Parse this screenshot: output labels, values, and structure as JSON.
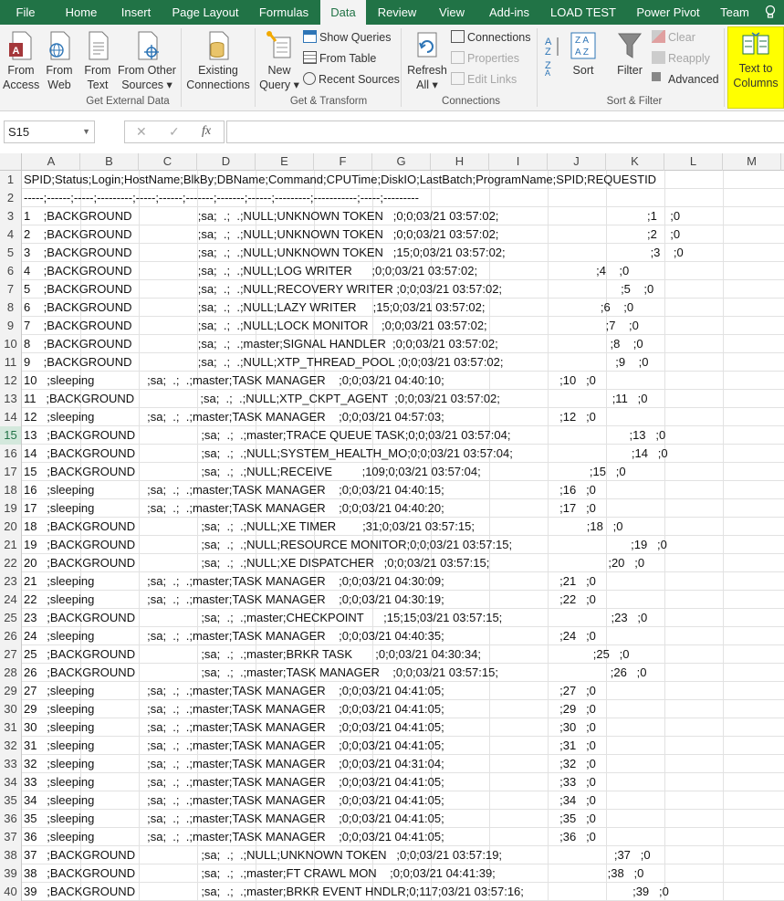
{
  "tabs": [
    "File",
    "Home",
    "Insert",
    "Page Layout",
    "Formulas",
    "Data",
    "Review",
    "View",
    "Add-ins",
    "LOAD TEST",
    "Power Pivot",
    "Team"
  ],
  "ribbon": {
    "get_external": {
      "from_access": [
        "From",
        "Access"
      ],
      "from_web": [
        "From",
        "Web"
      ],
      "from_text": [
        "From",
        "Text"
      ],
      "from_other": [
        "From Other",
        "Sources ▾"
      ],
      "existing": [
        "Existing",
        "Connections"
      ],
      "label": "Get External Data"
    },
    "get_transform": {
      "new_query": [
        "New",
        "Query ▾"
      ],
      "show_queries": "Show Queries",
      "from_table": "From Table",
      "recent_sources": "Recent Sources",
      "label": "Get & Transform"
    },
    "connections": {
      "refresh_all": [
        "Refresh",
        "All ▾"
      ],
      "connections": "Connections",
      "properties": "Properties",
      "edit_links": "Edit Links",
      "label": "Connections"
    },
    "sort_filter": {
      "sort": "Sort",
      "filter": "Filter",
      "clear": "Clear",
      "reapply": "Reapply",
      "advanced": "Advanced",
      "label": "Sort & Filter"
    },
    "data_tools": {
      "text_to_columns": [
        "Text to",
        "Columns"
      ]
    }
  },
  "formula_bar": {
    "name_box": "S15",
    "cancel": "✕",
    "enter": "✓",
    "fx": "fx",
    "formula": ""
  },
  "columns": [
    "A",
    "B",
    "C",
    "D",
    "E",
    "F",
    "G",
    "H",
    "I",
    "J",
    "K",
    "L",
    "M"
  ],
  "selected_row": 15,
  "rows": [
    {
      "n": "1",
      "text": "SPID;Status;Login;HostName;BlkBy;DBName;Command;CPUTime;DiskIO;LastBatch;ProgramName;SPID;REQUESTID"
    },
    {
      "n": "2",
      "text": "-----;------;-----;---------;-----;------;-------;-------;------;---------;-----------;-----;---------"
    },
    {
      "n": "3",
      "text": "1    ;BACKGROUND                    ;sa;  .;  .;NULL;UNKNOWN TOKEN   ;0;0;03/21 03:57:02;                                             ;1    ;0"
    },
    {
      "n": "4",
      "text": "2    ;BACKGROUND                    ;sa;  .;  .;NULL;UNKNOWN TOKEN   ;0;0;03/21 03:57:02;                                             ;2    ;0"
    },
    {
      "n": "5",
      "text": "3    ;BACKGROUND                    ;sa;  .;  .;NULL;UNKNOWN TOKEN   ;15;0;03/21 03:57:02;                                            ;3    ;0"
    },
    {
      "n": "6",
      "text": "4    ;BACKGROUND                    ;sa;  .;  .;NULL;LOG WRITER      ;0;0;03/21 03:57:02;                                    ;4    ;0"
    },
    {
      "n": "7",
      "text": "5    ;BACKGROUND                    ;sa;  .;  .;NULL;RECOVERY WRITER ;0;0;03/21 03:57:02;                                    ;5    ;0"
    },
    {
      "n": "8",
      "text": "6    ;BACKGROUND                    ;sa;  .;  .;NULL;LAZY WRITER     ;15;0;03/21 03:57:02;                                   ;6    ;0"
    },
    {
      "n": "9",
      "text": "7    ;BACKGROUND                    ;sa;  .;  .;NULL;LOCK MONITOR    ;0;0;03/21 03:57:02;                                    ;7    ;0"
    },
    {
      "n": "10",
      "text": "8    ;BACKGROUND                    ;sa;  .;  .;master;SIGNAL HANDLER  ;0;0;03/21 03:57:02;                                  ;8    ;0"
    },
    {
      "n": "11",
      "text": "9    ;BACKGROUND                    ;sa;  .;  .;NULL;XTP_THREAD_POOL ;0;0;03/21 03:57:02;                                  ;9    ;0"
    },
    {
      "n": "12",
      "text": "10   ;sleeping                ;sa;  .;  .;master;TASK MANAGER    ;0;0;03/21 04:40:10;                                   ;10   ;0"
    },
    {
      "n": "13",
      "text": "11   ;BACKGROUND                    ;sa;  .;  .;NULL;XTP_CKPT_AGENT  ;0;0;03/21 03:57:02;                                  ;11   ;0"
    },
    {
      "n": "14",
      "text": "12   ;sleeping                ;sa;  .;  .;master;TASK MANAGER    ;0;0;03/21 04:57:03;                                   ;12   ;0"
    },
    {
      "n": "15",
      "text": "13   ;BACKGROUND                    ;sa;  .;  .;master;TRACE QUEUE TASK;0;0;03/21 03:57:04;                                    ;13   ;0"
    },
    {
      "n": "16",
      "text": "14   ;BACKGROUND                    ;sa;  .;  .;NULL;SYSTEM_HEALTH_MO;0;0;03/21 03:57:04;                                    ;14   ;0"
    },
    {
      "n": "17",
      "text": "15   ;BACKGROUND                    ;sa;  .;  .;NULL;RECEIVE         ;109;0;03/21 03:57:04;                                 ;15   ;0"
    },
    {
      "n": "18",
      "text": "16   ;sleeping                ;sa;  .;  .;master;TASK MANAGER    ;0;0;03/21 04:40:15;                                   ;16   ;0"
    },
    {
      "n": "19",
      "text": "17   ;sleeping                ;sa;  .;  .;master;TASK MANAGER    ;0;0;03/21 04:40:20;                                   ;17   ;0"
    },
    {
      "n": "20",
      "text": "18   ;BACKGROUND                    ;sa;  .;  .;NULL;XE TIMER        ;31;0;03/21 03:57:15;                                  ;18   ;0"
    },
    {
      "n": "21",
      "text": "19   ;BACKGROUND                    ;sa;  .;  .;NULL;RESOURCE MONITOR;0;0;03/21 03:57:15;                                    ;19   ;0"
    },
    {
      "n": "22",
      "text": "20   ;BACKGROUND                    ;sa;  .;  .;NULL;XE DISPATCHER   ;0;0;03/21 03:57:15;                                    ;20   ;0"
    },
    {
      "n": "23",
      "text": "21   ;sleeping                ;sa;  .;  .;master;TASK MANAGER    ;0;0;03/21 04:30:09;                                   ;21   ;0"
    },
    {
      "n": "24",
      "text": "22   ;sleeping                ;sa;  .;  .;master;TASK MANAGER    ;0;0;03/21 04:30:19;                                   ;22   ;0"
    },
    {
      "n": "25",
      "text": "23   ;BACKGROUND                    ;sa;  .;  .;master;CHECKPOINT      ;15;15;03/21 03:57:15;                                 ;23   ;0"
    },
    {
      "n": "26",
      "text": "24   ;sleeping                ;sa;  .;  .;master;TASK MANAGER    ;0;0;03/21 04:40:35;                                   ;24   ;0"
    },
    {
      "n": "27",
      "text": "25   ;BACKGROUND                    ;sa;  .;  .;master;BRKR TASK       ;0;0;03/21 04:30:34;                                  ;25   ;0"
    },
    {
      "n": "28",
      "text": "26   ;BACKGROUND                    ;sa;  .;  .;master;TASK MANAGER    ;0;0;03/21 03:57:15;                                  ;26   ;0"
    },
    {
      "n": "29",
      "text": "27   ;sleeping                ;sa;  .;  .;master;TASK MANAGER    ;0;0;03/21 04:41:05;                                   ;27   ;0"
    },
    {
      "n": "30",
      "text": "29   ;sleeping                ;sa;  .;  .;master;TASK MANAGER    ;0;0;03/21 04:41:05;                                   ;29   ;0"
    },
    {
      "n": "31",
      "text": "30   ;sleeping                ;sa;  .;  .;master;TASK MANAGER    ;0;0;03/21 04:41:05;                                   ;30   ;0"
    },
    {
      "n": "32",
      "text": "31   ;sleeping                ;sa;  .;  .;master;TASK MANAGER    ;0;0;03/21 04:41:05;                                   ;31   ;0"
    },
    {
      "n": "33",
      "text": "32   ;sleeping                ;sa;  .;  .;master;TASK MANAGER    ;0;0;03/21 04:31:04;                                   ;32   ;0"
    },
    {
      "n": "34",
      "text": "33   ;sleeping                ;sa;  .;  .;master;TASK MANAGER    ;0;0;03/21 04:41:05;                                   ;33   ;0"
    },
    {
      "n": "35",
      "text": "34   ;sleeping                ;sa;  .;  .;master;TASK MANAGER    ;0;0;03/21 04:41:05;                                   ;34   ;0"
    },
    {
      "n": "36",
      "text": "35   ;sleeping                ;sa;  .;  .;master;TASK MANAGER    ;0;0;03/21 04:41:05;                                   ;35   ;0"
    },
    {
      "n": "37",
      "text": "36   ;sleeping                ;sa;  .;  .;master;TASK MANAGER    ;0;0;03/21 04:41:05;                                   ;36   ;0"
    },
    {
      "n": "38",
      "text": "37   ;BACKGROUND                    ;sa;  .;  .;NULL;UNKNOWN TOKEN   ;0;0;03/21 03:57:19;                                  ;37   ;0"
    },
    {
      "n": "39",
      "text": "38   ;BACKGROUND                    ;sa;  .;  .;master;FT CRAWL MON    ;0;0;03/21 04:41:39;                                  ;38   ;0"
    },
    {
      "n": "40",
      "text": "39   ;BACKGROUND                    ;sa;  .;  .;master;BRKR EVENT HNDLR;0;117;03/21 03:57:16;                                 ;39   ;0"
    }
  ]
}
